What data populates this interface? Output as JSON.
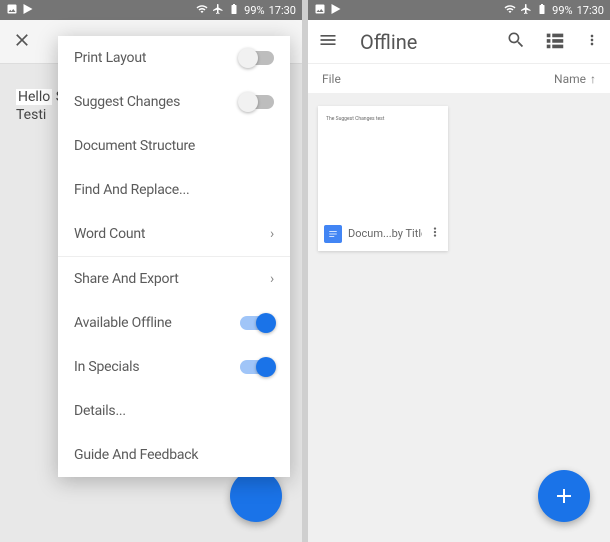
{
  "statusbar": {
    "battery": "99%",
    "time": "17:30"
  },
  "left": {
    "doc_hello": "Hello",
    "doc_suggest": "Suggest Changes",
    "doc_test": "Testi",
    "menu": {
      "print_layout": "Print Layout",
      "suggest_changes": "Suggest Changes",
      "document_structure": "Document Structure",
      "find_replace": "Find And Replace...",
      "word_count": "Word Count",
      "share_export": "Share And Export",
      "available_offline": "Available Offline",
      "in_specials": "In Specials",
      "details": "Details...",
      "guide_feedback": "Guide And Feedback",
      "toggles": {
        "print_layout": false,
        "suggest_changes": false,
        "available_offline": true,
        "in_specials": true
      }
    }
  },
  "right": {
    "title": "Offline",
    "subbar": {
      "file": "File",
      "sort": "Name"
    },
    "doc": {
      "title": "Docum...by Title",
      "thumb_text": "The Suggest Changes test"
    }
  }
}
